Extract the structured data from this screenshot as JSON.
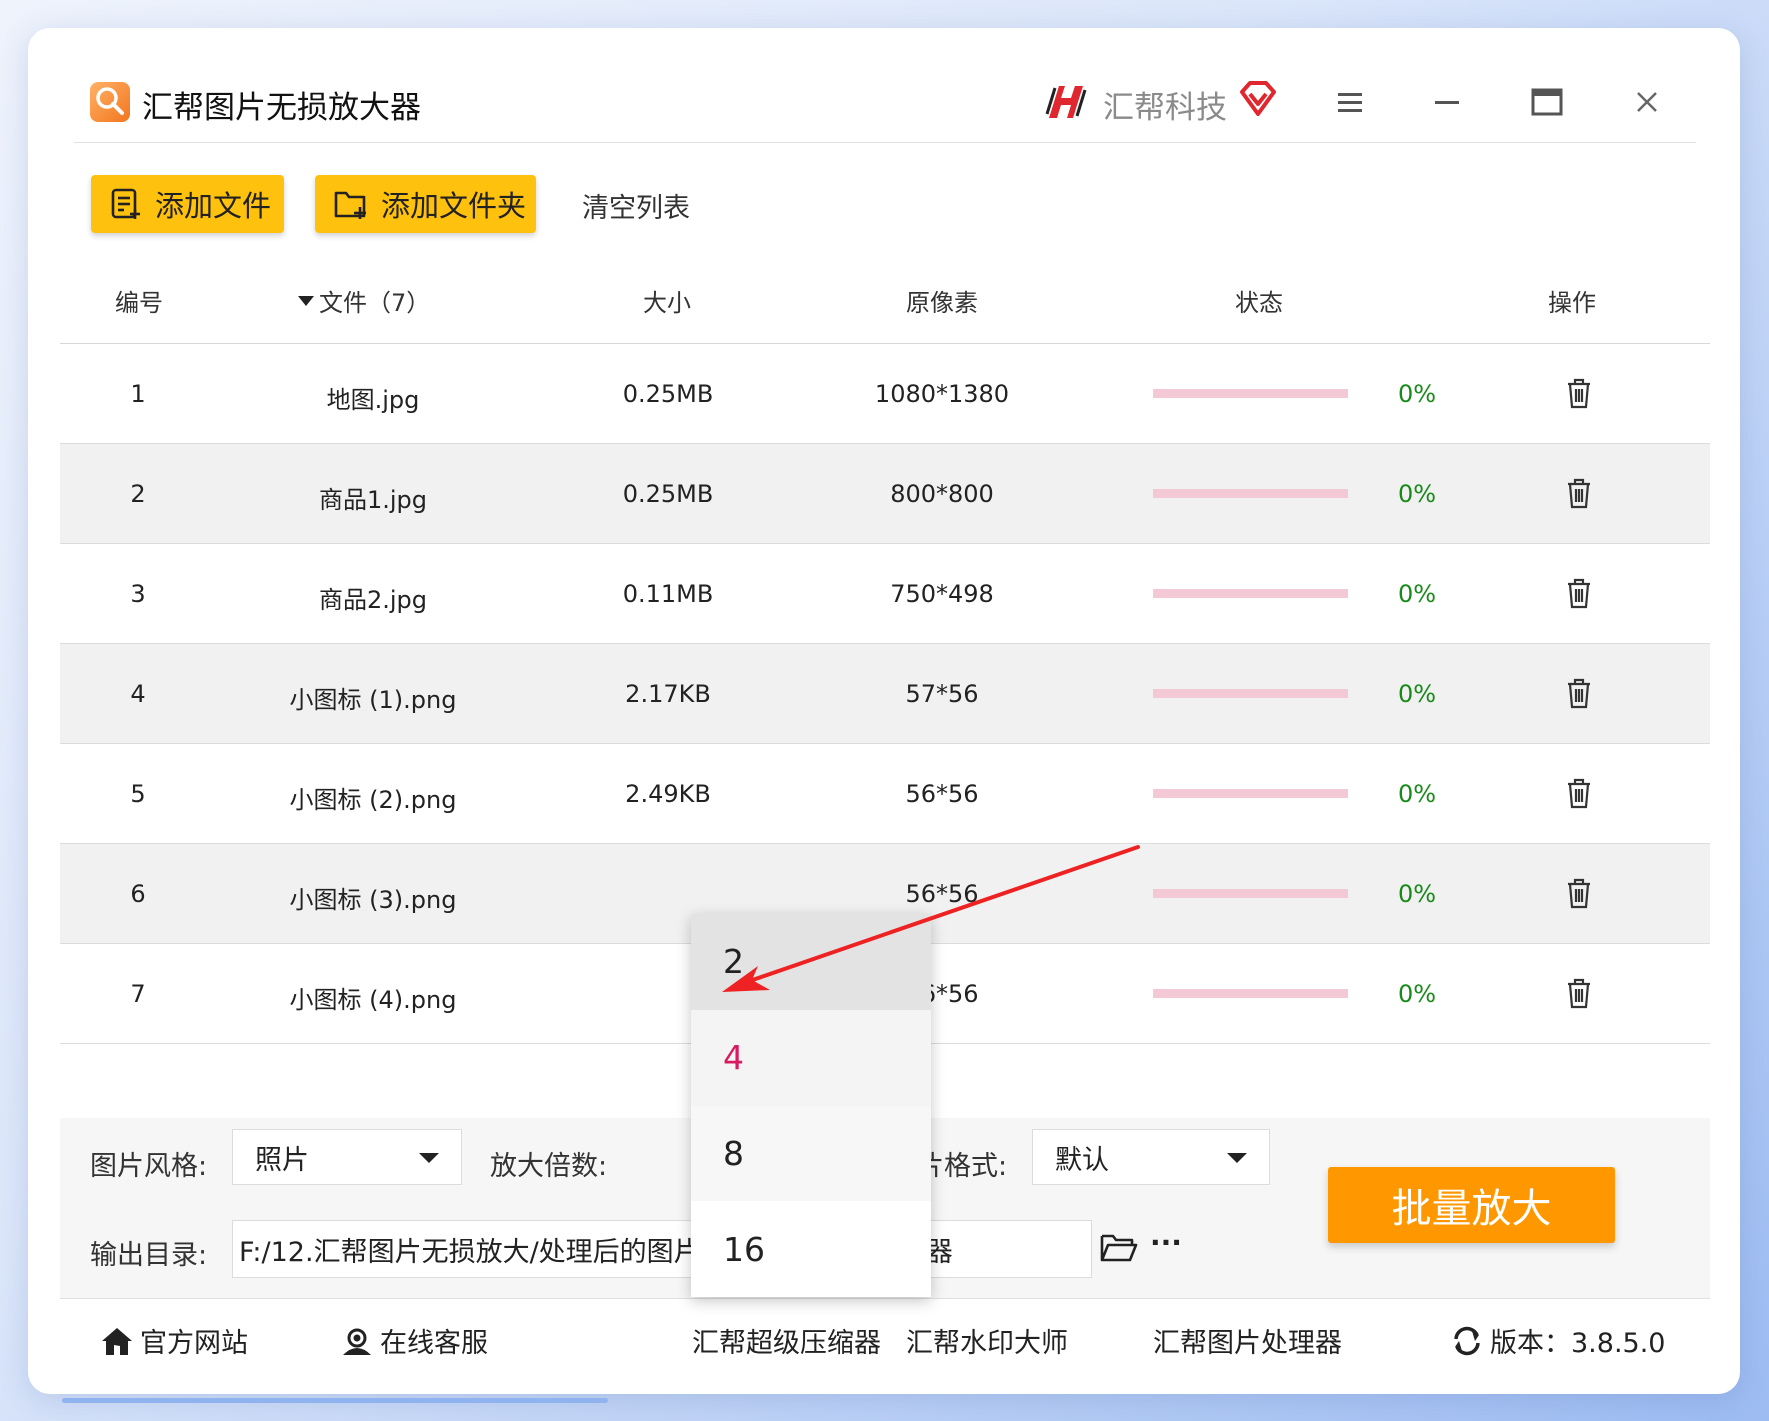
{
  "app": {
    "title": "汇帮图片无损放大器",
    "brand": "汇帮科技"
  },
  "toolbar": {
    "add_file": "添加文件",
    "add_folder": "添加文件夹",
    "clear_list": "清空列表"
  },
  "table": {
    "headers": {
      "index": "编号",
      "file": "文件（7）",
      "size": "大小",
      "pixels": "原像素",
      "status": "状态",
      "action": "操作"
    },
    "rows": [
      {
        "index": "1",
        "file": "地图.jpg",
        "size": "0.25MB",
        "pixels": "1080*1380",
        "progress": "0%",
        "progress_value": 0
      },
      {
        "index": "2",
        "file": "商品1.jpg",
        "size": "0.25MB",
        "pixels": "800*800",
        "progress": "0%",
        "progress_value": 0
      },
      {
        "index": "3",
        "file": "商品2.jpg",
        "size": "0.11MB",
        "pixels": "750*498",
        "progress": "0%",
        "progress_value": 0
      },
      {
        "index": "4",
        "file": "小图标 (1).png",
        "size": "2.17KB",
        "pixels": "57*56",
        "progress": "0%",
        "progress_value": 0
      },
      {
        "index": "5",
        "file": "小图标 (2).png",
        "size": "2.49KB",
        "pixels": "56*56",
        "progress": "0%",
        "progress_value": 0
      },
      {
        "index": "6",
        "file": "小图标 (3).png",
        "size": "",
        "pixels": "56*56",
        "progress": "0%",
        "progress_value": 0
      },
      {
        "index": "7",
        "file": "小图标 (4).png",
        "size": "",
        "pixels": "56*56",
        "progress": "0%",
        "progress_value": 0
      }
    ]
  },
  "settings": {
    "style_label": "图片风格:",
    "style_value": "照片",
    "scale_label": "放大倍数:",
    "format_label": "图片格式:",
    "format_value": "默认",
    "output_label": "输出目录:",
    "output_path": "F:/12.汇帮图片无损放大/处理后的图片/汇帮图片无损放大器",
    "more": "···",
    "batch_button": "批量放大"
  },
  "scale_dropdown": {
    "options": [
      "2",
      "4",
      "8",
      "16"
    ],
    "selected": "4",
    "hovered": "2"
  },
  "footer": {
    "website": "官方网站",
    "support": "在线客服",
    "compressor": "汇帮超级压缩器",
    "watermark": "汇帮水印大师",
    "image_processor": "汇帮图片处理器",
    "version": "版本：3.8.5.0"
  },
  "colors": {
    "accent_yellow": "#fec10e",
    "accent_orange": "#ff9700",
    "progress_track": "#f3c9d6",
    "percent_green": "#1a8a1a",
    "selected_pink": "#d81b60",
    "annotation_red": "#ee2222"
  }
}
